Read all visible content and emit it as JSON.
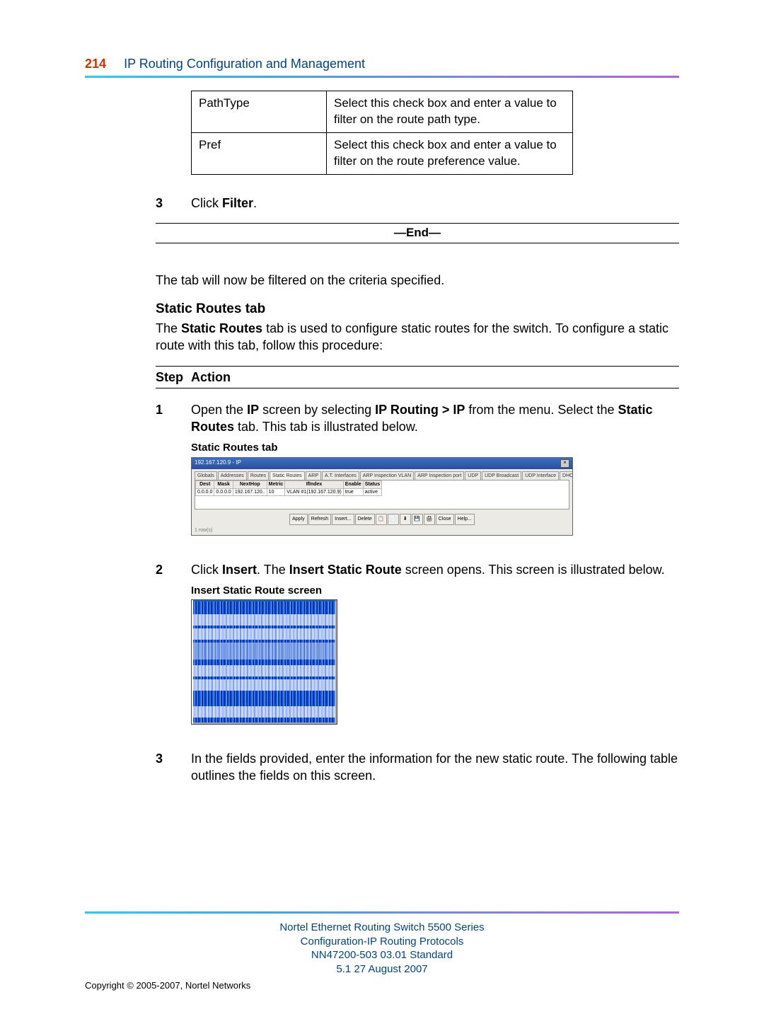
{
  "header": {
    "page_number": "214",
    "title": "IP Routing Configuration and Management"
  },
  "filter_table": {
    "rows": [
      {
        "name": "PathType",
        "desc": "Select this check box and enter a value to filter on the route path type."
      },
      {
        "name": "Pref",
        "desc": "Select this check box and enter a value to filter on the route preference value."
      }
    ]
  },
  "step3_top": {
    "num": "3",
    "prefix": "Click ",
    "bold": "Filter",
    "suffix": "."
  },
  "end_label": "—End—",
  "filtered_para": "The tab will now be filtered on the criteria specified.",
  "static_routes": {
    "heading": "Static Routes tab",
    "intro_parts": {
      "p1": "The ",
      "b1": "Static Routes",
      "p2": " tab is used to configure static routes for the switch. To configure a static route with this tab, follow this procedure:"
    },
    "step_action": {
      "step": "Step",
      "action": "Action"
    },
    "steps": [
      {
        "num": "1",
        "parts": {
          "t1": "Open the ",
          "b1": "IP",
          "t2": " screen by selecting ",
          "b2": "IP Routing > IP",
          "t3": " from the menu. Select the ",
          "b3": "Static Routes",
          "t4": " tab. This tab is illustrated below."
        },
        "caption": "Static Routes tab",
        "screenshot": {
          "title": "192.167.120.9 - IP",
          "tabs": [
            "Globals",
            "Addresses",
            "Routes",
            "Static Routes",
            "ARP",
            "A.T. Interfaces",
            "ARP Inspection VLAN",
            "ARP Inspection port",
            "UDP",
            "UDP Broadcast",
            "UDP Interface",
            "DHCP"
          ],
          "active_tab": 3,
          "cols": [
            "Dest",
            "Mask",
            "NextHop",
            "Metric",
            "IfIndex",
            "Enable",
            "Status"
          ],
          "row": [
            "0.0.0.0",
            "0.0.0.0",
            "192.167.120..",
            "10",
            "VLAN #1(192.167.120.9)",
            "true",
            "active"
          ],
          "buttons": [
            "Apply",
            "Refresh",
            "Insert...",
            "Delete"
          ],
          "buttons2": [
            "Close",
            "Help..."
          ],
          "footer": "1 row(s)"
        }
      },
      {
        "num": "2",
        "parts": {
          "t1": "Click ",
          "b1": "Insert",
          "t2": ". The ",
          "b2": "Insert Static Route",
          "t3": " screen opens. This screen is illustrated below."
        },
        "caption": "Insert Static Route screen"
      },
      {
        "num": "3",
        "parts": {
          "t1": "In the fields provided, enter the information for the new static route. The following table outlines the fields on this screen."
        }
      }
    ]
  },
  "footer": {
    "line1": "Nortel Ethernet Routing Switch 5500 Series",
    "line2": "Configuration-IP Routing Protocols",
    "line3": "NN47200-503   03.01   Standard",
    "line4": "5.1   27 August 2007",
    "copyright": "Copyright © 2005-2007, Nortel Networks"
  }
}
